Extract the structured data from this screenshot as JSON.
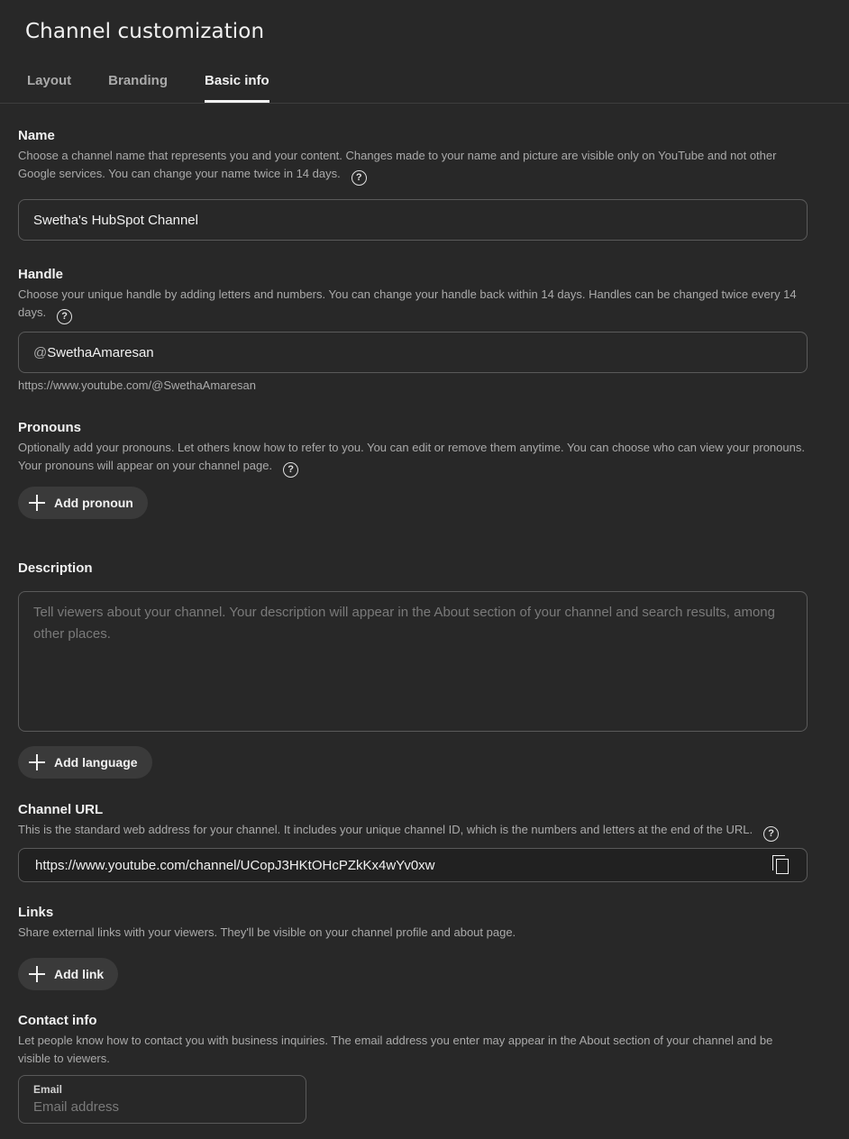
{
  "header": {
    "title": "Channel customization",
    "tabs": [
      {
        "label": "Layout",
        "active": false
      },
      {
        "label": "Branding",
        "active": false
      },
      {
        "label": "Basic info",
        "active": true
      }
    ]
  },
  "name": {
    "title": "Name",
    "description": "Choose a channel name that represents you and your content. Changes made to your name and picture are visible only on YouTube and not other Google services. You can change your name twice in 14 days.",
    "value": "Swetha's HubSpot Channel",
    "help_icon": "question-circle"
  },
  "handle": {
    "title": "Handle",
    "description": "Choose your unique handle by adding letters and numbers. You can change your handle back within 14 days. Handles can be changed twice every 14 days.",
    "prefix": "@",
    "value": "SwethaAmaresan",
    "url": "https://www.youtube.com/@SwethaAmaresan",
    "help_icon": "question-circle"
  },
  "pronouns": {
    "title": "Pronouns",
    "description": "Optionally add your pronouns. Let others know how to refer to you. You can edit or remove them anytime. You can choose who can view your pronouns. Your pronouns will appear on your channel page.",
    "button_label": "Add pronoun",
    "help_icon": "question-circle"
  },
  "description": {
    "title": "Description",
    "placeholder": "Tell viewers about your channel. Your description will appear in the About section of your channel and search results, among other places.",
    "value": "",
    "add_language_label": "Add language"
  },
  "channel_url": {
    "title": "Channel URL",
    "description": "This is the standard web address for your channel. It includes your unique channel ID, which is the numbers and letters at the end of the URL.",
    "value": "https://www.youtube.com/channel/UCopJ3HKtOHcPZkKx4wYv0xw",
    "help_icon": "question-circle",
    "copy_icon": "copy"
  },
  "links": {
    "title": "Links",
    "description": "Share external links with your viewers. They'll be visible on your channel profile and about page.",
    "button_label": "Add link"
  },
  "contact": {
    "title": "Contact info",
    "description": "Let people know how to contact you with business inquiries. The email address you enter may appear in the About section of your channel and be visible to viewers.",
    "email_label": "Email",
    "email_placeholder": "Email address",
    "email_value": ""
  },
  "colors": {
    "background": "#282828",
    "text_primary": "#f1f1f1",
    "text_secondary": "#aaaaaa",
    "button_bg": "#3a3a3a",
    "border": "#5a5a5a"
  }
}
